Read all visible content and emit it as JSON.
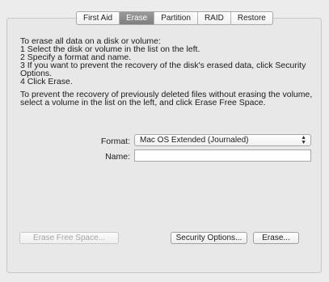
{
  "tabs": [
    {
      "label": "First Aid",
      "active": false
    },
    {
      "label": "Erase",
      "active": true
    },
    {
      "label": "Partition",
      "active": false
    },
    {
      "label": "RAID",
      "active": false
    },
    {
      "label": "Restore",
      "active": false
    }
  ],
  "instructions": [
    "To erase all data on a disk or volume:",
    "1 Select the disk or volume in the list on the left.",
    "2 Specify a format and name.",
    "3 If you want to prevent the recovery of the disk's erased data, click Security Options.",
    "4 Click Erase."
  ],
  "free_space_text": "To prevent the recovery of previously deleted files without erasing the volume, select a volume in the list on the left, and click Erase Free Space.",
  "format": {
    "label": "Format:",
    "value": "Mac OS Extended (Journaled)"
  },
  "name": {
    "label": "Name:",
    "value": ""
  },
  "buttons": {
    "erase_free_space": "Erase Free Space...",
    "security_options": "Security Options...",
    "erase": "Erase..."
  },
  "colors": {
    "active_tab": "#8a8a8a",
    "panel_background": "#e8e8e8"
  }
}
